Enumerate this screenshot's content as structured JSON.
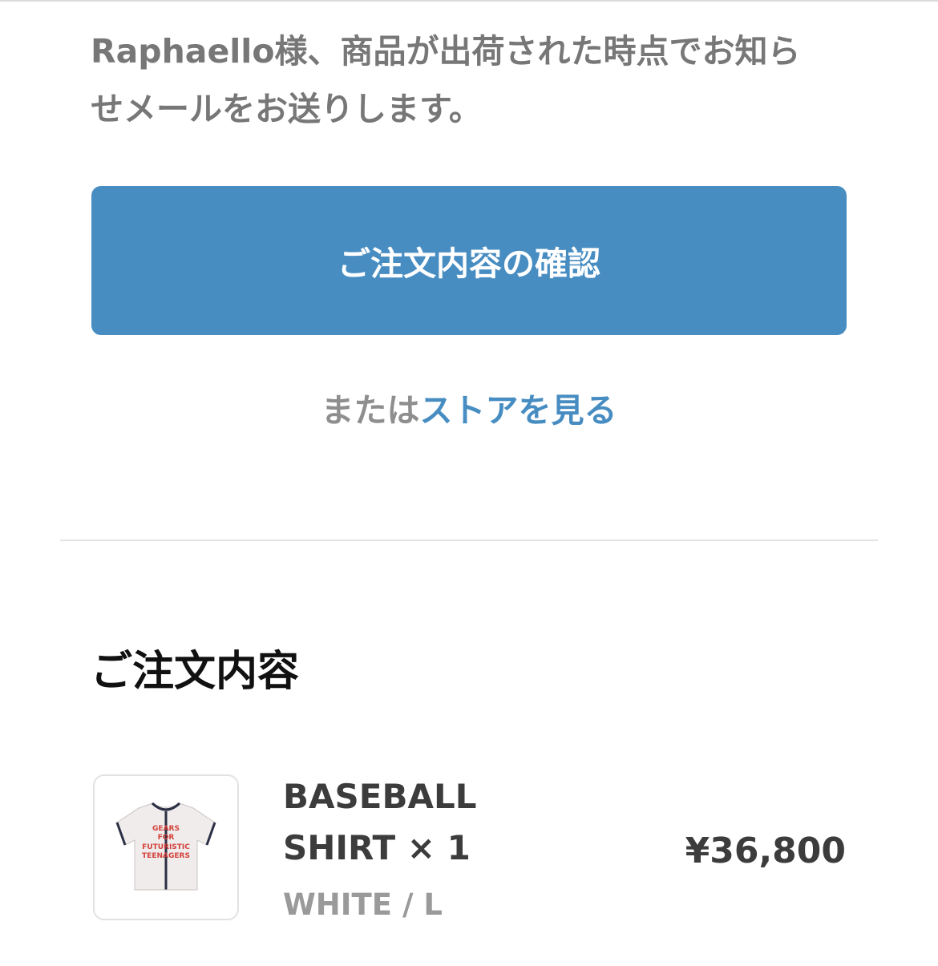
{
  "intro": {
    "line1": "Raphaello様、商品が出荷された時点でお知ら",
    "line2": "せメールをお送りします。"
  },
  "confirm_button_label": "ご注文内容の確認",
  "store_link": {
    "prefix": "または",
    "link_text": "ストアを見る"
  },
  "order_summary": {
    "title": "ご注文内容",
    "items": [
      {
        "name_line1": "BASEBALL",
        "name_line2": "SHIRT × 1",
        "variant": "WHITE / L",
        "price": "¥36,800",
        "image_icon": "baseball-shirt-image",
        "shirt_print": [
          "GEARS",
          "FOR",
          "FUTURISTIC",
          "TEENAGERS"
        ]
      }
    ]
  },
  "colors": {
    "accent": "#478dc2",
    "muted_text": "#777777",
    "body_text": "#3c3c3c"
  }
}
